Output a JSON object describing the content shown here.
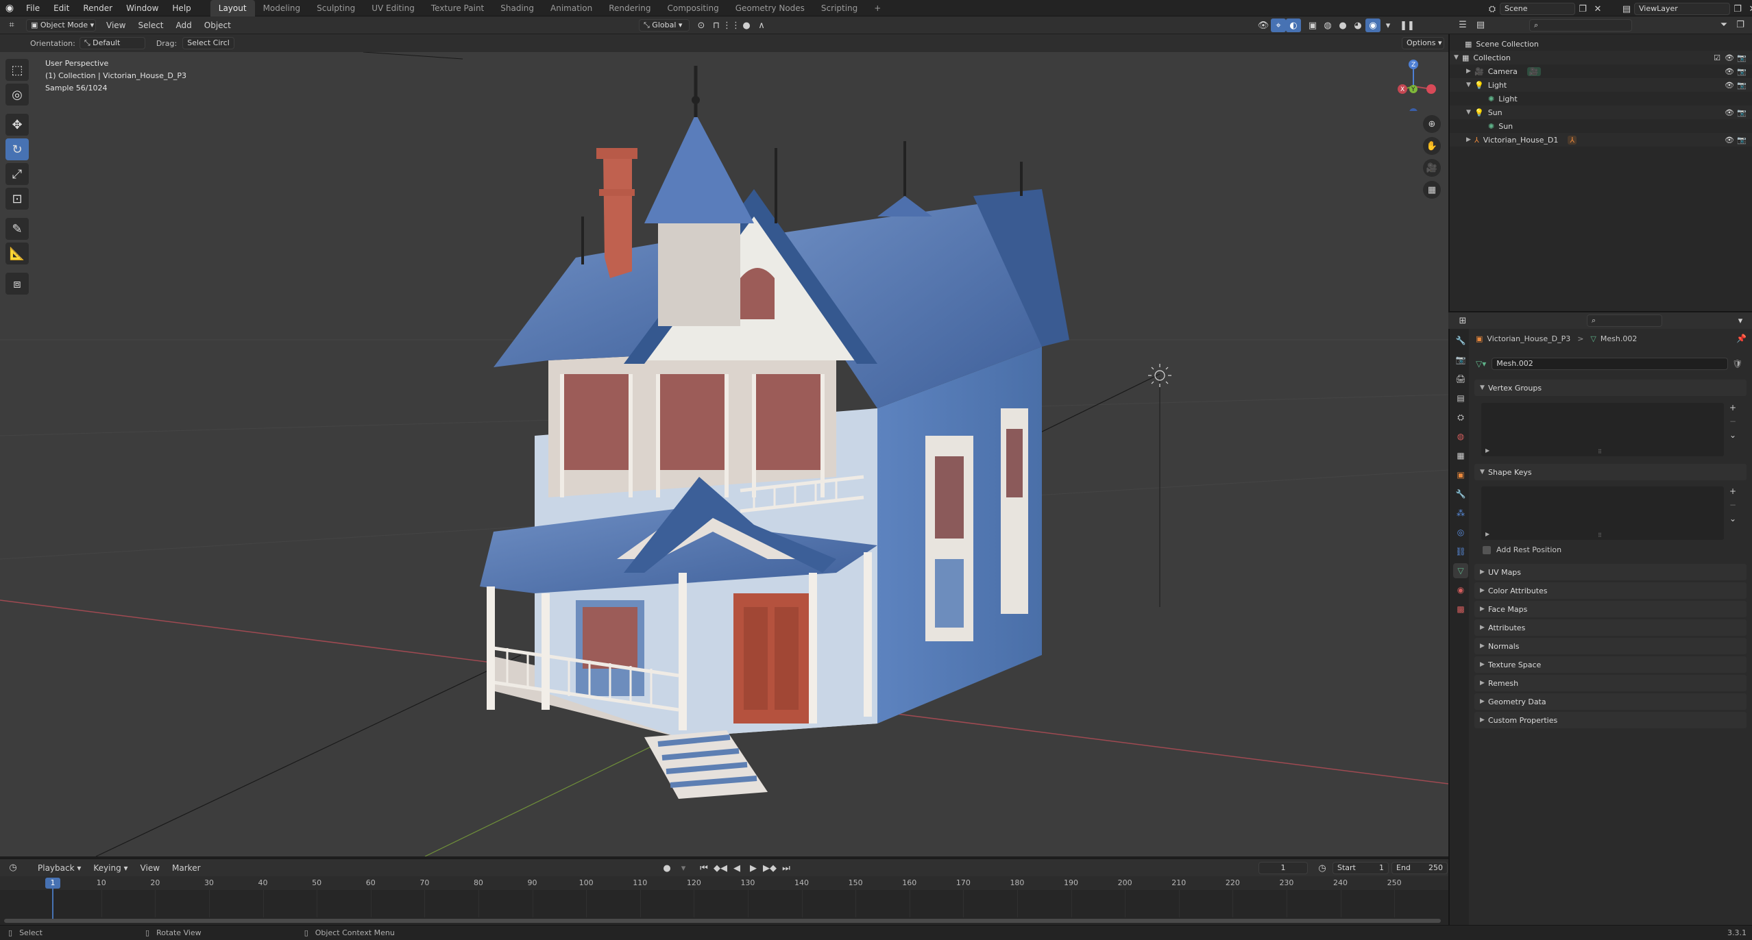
{
  "topbar": {
    "menus": [
      "File",
      "Edit",
      "Render",
      "Window",
      "Help"
    ],
    "workspaces": [
      "Layout",
      "Modeling",
      "Sculpting",
      "UV Editing",
      "Texture Paint",
      "Shading",
      "Animation",
      "Rendering",
      "Compositing",
      "Geometry Nodes",
      "Scripting"
    ],
    "active_workspace": "Layout",
    "add_workspace": "+",
    "scene": "Scene",
    "view_layer": "ViewLayer"
  },
  "viewport_header": {
    "mode": "Object Mode",
    "menus": [
      "View",
      "Select",
      "Add",
      "Object"
    ],
    "transform": "Global",
    "orientation_label": "Orientation:",
    "orientation_value": "Default",
    "drag_label": "Drag:",
    "drag_value": "Select Circl",
    "options": "Options"
  },
  "viewport": {
    "perspective": "User Perspective",
    "collection_info": "(1) Collection | Victorian_House_D_P3",
    "sample": "Sample 56/1024",
    "gizmo_axes": [
      "Z",
      "X",
      "Y"
    ],
    "colors": {
      "bg": "#3d3d3d",
      "x_axis": "#b54b55",
      "y_axis": "#78a236",
      "z_axis": "#4d7fd4"
    }
  },
  "outliner": {
    "search_placeholder": "",
    "scene_collection": "Scene Collection",
    "collection": "Collection",
    "items": [
      {
        "label": "Camera",
        "indent": 2
      },
      {
        "label": "Light",
        "indent": 2
      },
      {
        "label": "Light",
        "indent": 3
      },
      {
        "label": "Sun",
        "indent": 2
      },
      {
        "label": "Sun",
        "indent": 3
      },
      {
        "label": "Victorian_House_D1",
        "indent": 2
      }
    ]
  },
  "properties": {
    "breadcrumb_object": "Victorian_House_D_P3",
    "breadcrumb_sep": ">",
    "breadcrumb_mesh": "Mesh.002",
    "mesh_name": "Mesh.002",
    "vertex_groups": "Vertex Groups",
    "shape_keys": "Shape Keys",
    "add_rest_position": "Add Rest Position",
    "panels": [
      "UV Maps",
      "Color Attributes",
      "Face Maps",
      "Attributes",
      "Normals",
      "Texture Space",
      "Remesh",
      "Geometry Data",
      "Custom Properties"
    ]
  },
  "timeline": {
    "menus": [
      "Playback",
      "Keying",
      "View",
      "Marker"
    ],
    "current_frame": "1",
    "start_label": "Start",
    "start": "1",
    "end_label": "End",
    "end": "250",
    "ticks": [
      "1",
      "10",
      "20",
      "30",
      "40",
      "50",
      "60",
      "70",
      "80",
      "90",
      "100",
      "110",
      "120",
      "130",
      "140",
      "150",
      "160",
      "170",
      "180",
      "190",
      "200",
      "210",
      "220",
      "230",
      "240",
      "250"
    ]
  },
  "statusbar": {
    "select": "Select",
    "rotate_view": "Rotate View",
    "context_menu": "Object Context Menu",
    "version": "3.3.1"
  }
}
